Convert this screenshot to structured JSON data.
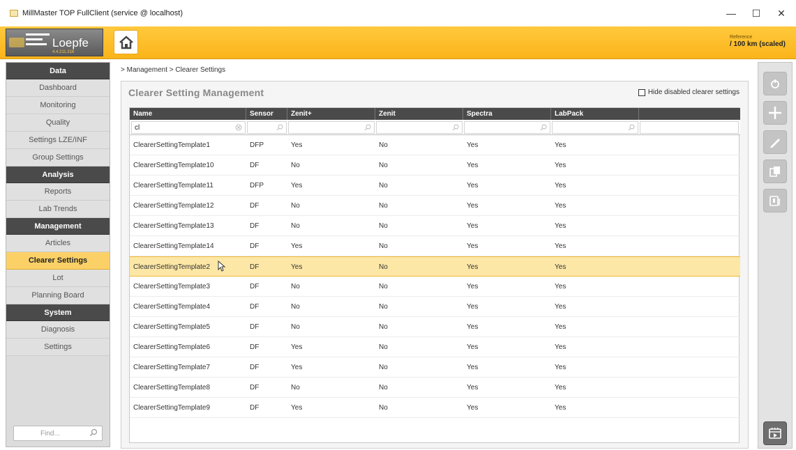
{
  "window": {
    "title": "MillMaster TOP FullClient (service @ localhost)",
    "controls": {
      "minimize": "—",
      "maximize": "☐",
      "close": "✕"
    }
  },
  "header": {
    "logo_text": "Loepfe",
    "logo_version": "4.4.211.318",
    "reference_label": "Reference",
    "reference_value": "/ 100 km (scaled)",
    "home_icon": "home-icon"
  },
  "sidebar": {
    "groups": [
      {
        "title": "Data",
        "items": [
          "Dashboard",
          "Monitoring",
          "Quality",
          "Settings LZE/INF",
          "Group Settings"
        ]
      },
      {
        "title": "Analysis",
        "items": [
          "Reports",
          "Lab Trends"
        ]
      },
      {
        "title": "Management",
        "items": [
          "Articles",
          "Clearer Settings",
          "Lot",
          "Planning Board"
        ]
      },
      {
        "title": "System",
        "items": [
          "Diagnosis",
          "Settings"
        ]
      }
    ],
    "active_item": "Clearer Settings",
    "find_placeholder": "Find..."
  },
  "breadcrumb": "> Management > Clearer Settings",
  "panel": {
    "title": "Clearer Setting Management",
    "hide_disabled_label": "Hide disabled clearer settings",
    "hide_disabled_checked": false
  },
  "table": {
    "columns": [
      "Name",
      "Sensor",
      "Zenit+",
      "Zenit",
      "Spectra",
      "LabPack"
    ],
    "filters": [
      "cl",
      "",
      "",
      "",
      "",
      ""
    ],
    "selected_row": 6,
    "rows": [
      [
        "ClearerSettingTemplate1",
        "DFP",
        "Yes",
        "No",
        "Yes",
        "Yes"
      ],
      [
        "ClearerSettingTemplate10",
        "DF",
        "No",
        "No",
        "Yes",
        "Yes"
      ],
      [
        "ClearerSettingTemplate11",
        "DFP",
        "Yes",
        "No",
        "Yes",
        "Yes"
      ],
      [
        "ClearerSettingTemplate12",
        "DF",
        "No",
        "No",
        "Yes",
        "Yes"
      ],
      [
        "ClearerSettingTemplate13",
        "DF",
        "No",
        "No",
        "Yes",
        "Yes"
      ],
      [
        "ClearerSettingTemplate14",
        "DF",
        "Yes",
        "No",
        "Yes",
        "Yes"
      ],
      [
        "ClearerSettingTemplate2",
        "DF",
        "Yes",
        "No",
        "Yes",
        "Yes"
      ],
      [
        "ClearerSettingTemplate3",
        "DF",
        "No",
        "No",
        "Yes",
        "Yes"
      ],
      [
        "ClearerSettingTemplate4",
        "DF",
        "No",
        "No",
        "Yes",
        "Yes"
      ],
      [
        "ClearerSettingTemplate5",
        "DF",
        "No",
        "No",
        "Yes",
        "Yes"
      ],
      [
        "ClearerSettingTemplate6",
        "DF",
        "Yes",
        "No",
        "Yes",
        "Yes"
      ],
      [
        "ClearerSettingTemplate7",
        "DF",
        "Yes",
        "No",
        "Yes",
        "Yes"
      ],
      [
        "ClearerSettingTemplate8",
        "DF",
        "No",
        "No",
        "Yes",
        "Yes"
      ],
      [
        "ClearerSettingTemplate9",
        "DF",
        "Yes",
        "No",
        "Yes",
        "Yes"
      ]
    ]
  },
  "toolbar": {
    "buttons": [
      {
        "icon": "refresh-icon",
        "enabled": false
      },
      {
        "icon": "add-icon",
        "enabled": false
      },
      {
        "icon": "edit-icon",
        "enabled": false
      },
      {
        "icon": "copy-icon",
        "enabled": false
      },
      {
        "icon": "import-icon",
        "enabled": false
      },
      {
        "icon": "media-icon",
        "enabled": true
      }
    ]
  },
  "colors": {
    "accent": "#fbb41a",
    "selected_row": "#fde7a6",
    "sidebar_active": "#fbd167",
    "header_dark": "#4a4a4a"
  }
}
